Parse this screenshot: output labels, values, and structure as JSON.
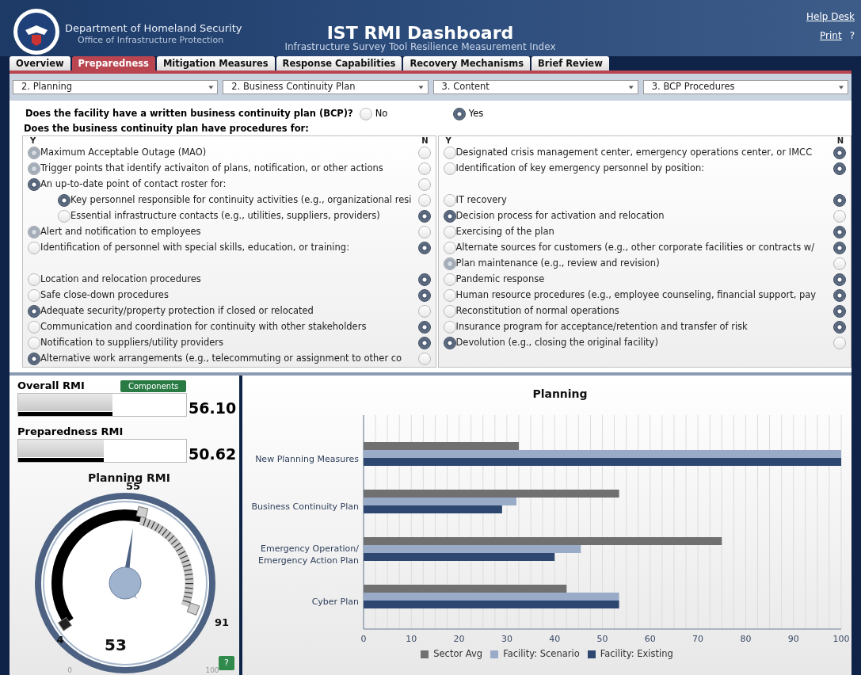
{
  "header": {
    "agency": "Department of Homeland Security",
    "office": "Office of Infrastructure Protection",
    "title": "IST RMI Dashboard",
    "subtitle": "Infrastructure Survey Tool Resilience Measurement Index",
    "links": [
      "Help Desk",
      "Print",
      "?"
    ]
  },
  "tabs": [
    {
      "label": "Overview",
      "selected": false
    },
    {
      "label": "Preparedness",
      "selected": true
    },
    {
      "label": "Mitigation Measures",
      "selected": false
    },
    {
      "label": "Response Capabilities",
      "selected": false
    },
    {
      "label": "Recovery Mechanisms",
      "selected": false
    },
    {
      "label": "Brief Review",
      "selected": false
    }
  ],
  "dropdowns": [
    "2. Planning",
    "2. Business Continuity Plan",
    "3. Content",
    "3. BCP Procedures"
  ],
  "question": {
    "text": "Does the facility have a written business continuity plan (BCP)?",
    "options": [
      {
        "label": "No",
        "selected": false
      },
      {
        "label": "Yes",
        "selected": true
      }
    ]
  },
  "procedures_prompt": "Does the business continuity plan have procedures for:",
  "panels": [
    {
      "yes_heading": "Y",
      "no_heading": "N",
      "items": [
        {
          "text": "Maximum Acceptable Outage (MAO)",
          "yes": true,
          "disabled": true,
          "no": false
        },
        {
          "text": "Trigger points that identify activaiton of plans, notification, or other actions",
          "yes": true,
          "disabled": true,
          "no": false
        },
        {
          "text": "An up-to-date point of contact roster for:",
          "yes": true,
          "disabled": false,
          "no": false,
          "children": [
            {
              "text": "Key personnel responsible for continuity activities (e.g., organizational resi",
              "yes": true,
              "disabled": false,
              "no": false
            },
            {
              "text": "Essential infrastructure contacts (e.g., utilities, suppliers, providers)",
              "yes": false,
              "disabled": false,
              "no": true
            }
          ]
        },
        {
          "text": "Alert and notification to employees",
          "yes": true,
          "disabled": true,
          "no": false
        },
        {
          "text": "Identification of personnel with special skills, education, or training:",
          "yes": false,
          "disabled": false,
          "no": true,
          "gap_after": true
        },
        {
          "text": "Location and relocation procedures",
          "yes": false,
          "disabled": false,
          "no": true
        },
        {
          "text": "Safe close-down procedures",
          "yes": false,
          "disabled": false,
          "no": true
        },
        {
          "text": "Adequate security/property protection if closed or relocated",
          "yes": true,
          "disabled": false,
          "no": false
        },
        {
          "text": "Communication and coordination for continuity with other stakeholders",
          "yes": false,
          "disabled": false,
          "no": true
        },
        {
          "text": "Notification to suppliers/utility providers",
          "yes": false,
          "disabled": false,
          "no": true
        },
        {
          "text": "Alternative work arrangements (e.g., telecommuting or assignment to other co",
          "yes": true,
          "disabled": false,
          "no": false
        }
      ]
    },
    {
      "yes_heading": "Y",
      "no_heading": "N",
      "items": [
        {
          "text": "Designated crisis management center, emergency operations center, or IMCC",
          "yes": false,
          "disabled": false,
          "no": true
        },
        {
          "text": "Identification of key emergency personnel by position:",
          "yes": false,
          "disabled": false,
          "no": true,
          "gap_after": true
        },
        {
          "text": "IT recovery",
          "yes": false,
          "disabled": false,
          "no": true
        },
        {
          "text": "Decision process for activation and relocation",
          "yes": true,
          "disabled": false,
          "no": false
        },
        {
          "text": "Exercising of the plan",
          "yes": false,
          "disabled": false,
          "no": true
        },
        {
          "text": "Alternate sources for customers (e.g., other corporate facilities or contracts w/",
          "yes": false,
          "disabled": false,
          "no": true
        },
        {
          "text": "Plan maintenance (e.g., review and revision)",
          "yes": true,
          "disabled": true,
          "no": false
        },
        {
          "text": "Pandemic response",
          "yes": false,
          "disabled": false,
          "no": true
        },
        {
          "text": "Human resource procedures (e.g., employee counseling, financial support, pay",
          "yes": false,
          "disabled": false,
          "no": true
        },
        {
          "text": "Reconstitution of normal operations",
          "yes": false,
          "disabled": false,
          "no": true
        },
        {
          "text": "Insurance program for acceptance/retention and transfer of risk",
          "yes": false,
          "disabled": false,
          "no": true
        },
        {
          "text": "Devolution (e.g., closing the original facility)",
          "yes": true,
          "disabled": false,
          "no": false
        }
      ]
    }
  ],
  "scores": [
    {
      "label": "Overall RMI",
      "value": "56.10",
      "level": 0.56,
      "button": "Components"
    },
    {
      "label": "Preparedness RMI",
      "value": "50.62",
      "level": 0.51
    }
  ],
  "gauge": {
    "title": "Planning RMI",
    "value": "53",
    "min_label": "0",
    "max_label": "100",
    "markers": [
      "4",
      "55",
      "91"
    ],
    "help": "?"
  },
  "chart": {
    "chart_data": {
      "type": "bar",
      "orientation": "horizontal",
      "title": "Planning",
      "grid": true,
      "legend": true,
      "categories": [
        "New Planning Measures",
        "Business Continuity Plan",
        "Emergency Operation/\nEmergency Action Plan",
        "Cyber Plan"
      ],
      "series": [
        {
          "name": "Sector Avg",
          "color": "#707070",
          "values": [
            32.5,
            53.5,
            75,
            42.5
          ]
        },
        {
          "name": "Facility: Scenario",
          "color": "#9aabc8",
          "values": [
            100,
            32,
            45.5,
            53.5
          ]
        },
        {
          "name": "Facility: Existing",
          "color": "#2d4770",
          "values": [
            100,
            29,
            40,
            53.5
          ]
        }
      ],
      "xlim": [
        0,
        100
      ],
      "xticks": [
        0,
        10,
        20,
        30,
        40,
        50,
        60,
        70,
        80,
        90,
        100
      ]
    }
  }
}
